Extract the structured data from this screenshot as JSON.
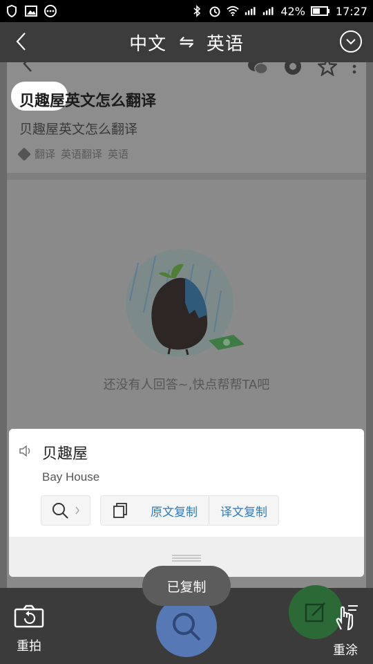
{
  "statusbar": {
    "battery": "42%",
    "time": "17:27"
  },
  "header": {
    "source_lang": "中文",
    "swap_symbol": "⇋",
    "target_lang": "英语"
  },
  "captured": {
    "title": "贝趣屋英文怎么翻译",
    "subtitle": "贝趣屋英文怎么翻译",
    "tags": [
      "翻译",
      "英语翻译",
      "英语"
    ],
    "empty_text": "还没有人回答~,快点帮帮TA吧"
  },
  "result": {
    "word": "贝趣屋",
    "translation": "Bay House",
    "copy_source": "原文复制",
    "copy_translation": "译文复制"
  },
  "toast": {
    "text": "已复制"
  },
  "bottom": {
    "rephoto_label": "重拍",
    "repaint_label": "重涂"
  }
}
